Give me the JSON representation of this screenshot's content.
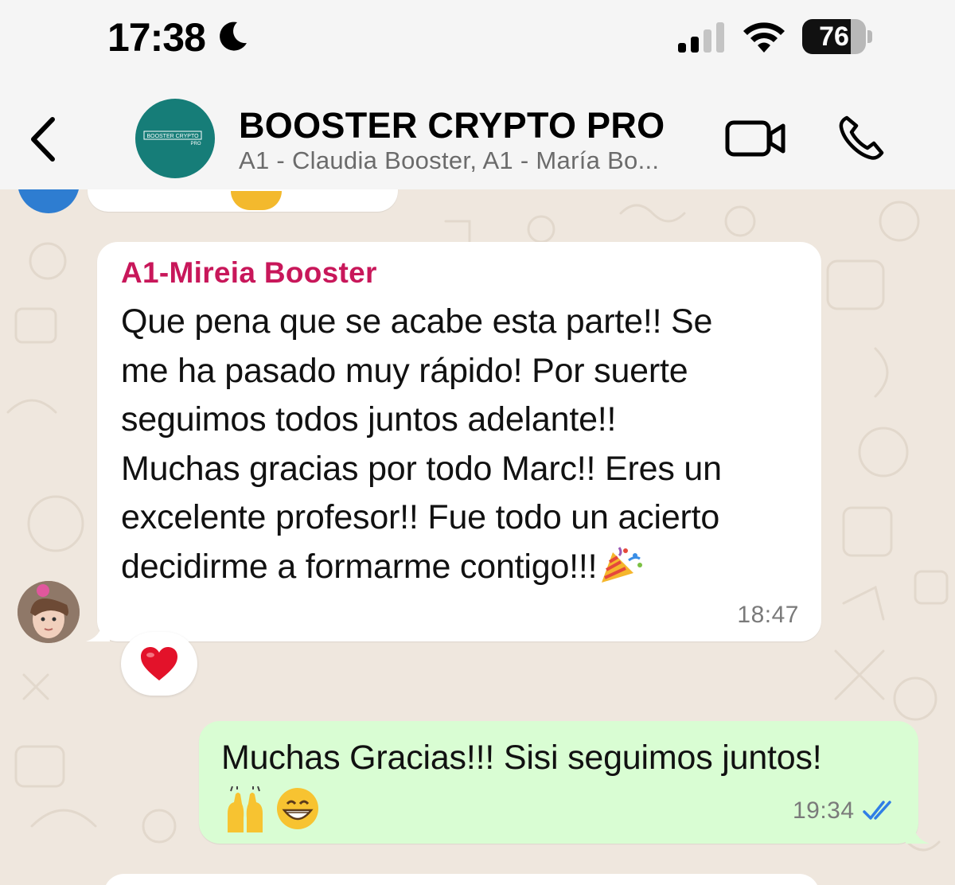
{
  "status_bar": {
    "time": "17:38",
    "battery": "76",
    "battery_level": 0.76
  },
  "header": {
    "title": "BOOSTER CRYPTO PRO",
    "subtitle": "A1 - Claudia Booster, A1 - María Bo...",
    "avatar_logo_text": "BOOSTER CRYPTO PRO"
  },
  "messages": [
    {
      "sender": "A1-Mireia Booster",
      "text_lines": [
        "Que pena que se acabe esta parte!! Se",
        "me ha pasado muy rápido! Por suerte",
        "seguimos todos juntos adelante!!",
        "Muchas gracias por todo Marc!! Eres un",
        "excelente profesor!! Fue todo un acierto",
        "decidirme a formarme contigo!!!"
      ],
      "emoji": "party-popper",
      "time": "18:47",
      "reaction": "red-heart"
    },
    {
      "text": "Muchas Gracias!!! Sisi seguimos juntos!",
      "emojis": [
        "raising-hands",
        "grinning-face"
      ],
      "time": "19:34",
      "status": "read"
    }
  ],
  "colors": {
    "sender_name": "#c8175a",
    "outgoing_bubble": "#d9fdd3",
    "read_ticks": "#2f7ee6",
    "wallpaper": "#efe7de"
  }
}
